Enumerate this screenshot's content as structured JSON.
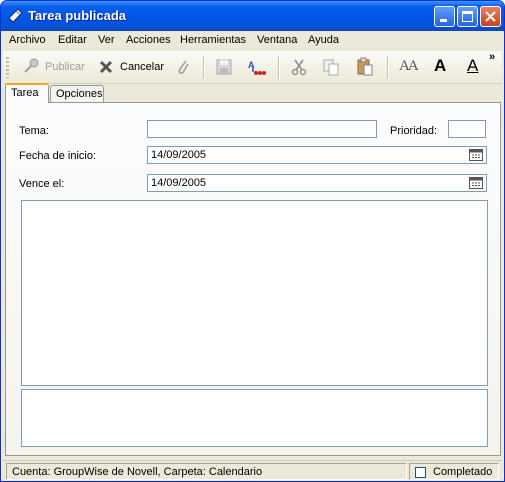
{
  "window": {
    "title": "Tarea publicada"
  },
  "menu": [
    "Archivo",
    "Editar",
    "Ver",
    "Acciones",
    "Herramientas",
    "Ventana",
    "Ayuda"
  ],
  "toolbar": {
    "publish_label": "Publicar",
    "cancel_label": "Cancelar",
    "overflow": "»",
    "font_size_glyph": "AA",
    "bold_glyph": "A",
    "underline_glyph": "A"
  },
  "tabs": [
    {
      "label": "Tarea",
      "active": true
    },
    {
      "label": "Opciones",
      "active": false
    }
  ],
  "form": {
    "subject_label": "Tema:",
    "subject_value": "",
    "priority_label": "Prioridad:",
    "priority_value": "",
    "start_label": "Fecha de inicio:",
    "start_value": "14/09/2005",
    "due_label": "Vence el:",
    "due_value": "14/09/2005"
  },
  "status": {
    "account_text": "Cuenta: GroupWise de Novell,  Carpeta: Calendario",
    "completed_label": "Completado",
    "completed": false
  },
  "colors": {
    "title_bar": "#0058ee",
    "tab_accent": "#f0a81c",
    "chrome": "#ece9d8",
    "close_button": "#c7431f"
  }
}
